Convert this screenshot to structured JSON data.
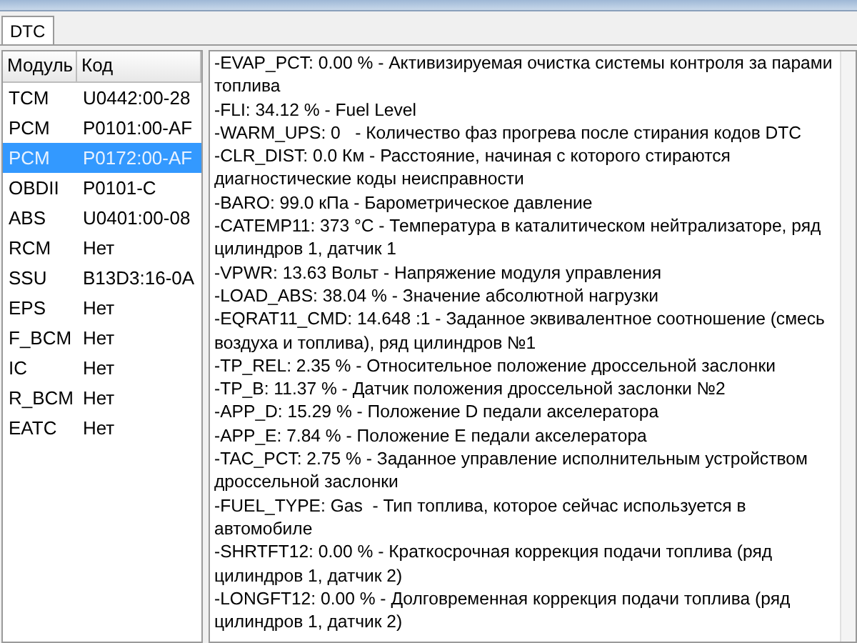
{
  "tabs": [
    {
      "label": "DTC",
      "selected": true
    }
  ],
  "modules": {
    "columns": [
      "Модуль",
      "Код"
    ],
    "rows": [
      {
        "module": "TCM",
        "code": "U0442:00-28",
        "selected": false
      },
      {
        "module": "PCM",
        "code": "P0101:00-AF",
        "selected": false
      },
      {
        "module": "PCM",
        "code": "P0172:00-AF",
        "selected": true
      },
      {
        "module": "OBDII",
        "code": "P0101-C",
        "selected": false
      },
      {
        "module": "ABS",
        "code": "U0401:00-08",
        "selected": false
      },
      {
        "module": "RCM",
        "code": "Нет",
        "selected": false
      },
      {
        "module": "SSU",
        "code": "B13D3:16-0A",
        "selected": false
      },
      {
        "module": "EPS",
        "code": "Нет",
        "selected": false
      },
      {
        "module": "F_BCM",
        "code": "Нет",
        "selected": false
      },
      {
        "module": "IC",
        "code": "Нет",
        "selected": false
      },
      {
        "module": "R_BCM",
        "code": "Нет",
        "selected": false
      },
      {
        "module": "EATC",
        "code": "Нет",
        "selected": false
      }
    ]
  },
  "details": [
    "-EVAP_PCT: 0.00 % - Активизируемая очистка системы контроля за парами топлива",
    "-FLI: 34.12 % - Fuel Level",
    "-WARM_UPS: 0   - Количество фаз прогрева после стирания кодов DTC",
    "-CLR_DIST: 0.0 Км - Расстояние, начиная с которого стираются диагностические коды неисправности",
    "-BARO: 99.0 кПа - Барометрическое давление",
    "-CATEMP11: 373 °C - Температура в каталитическом нейтрализаторе, ряд цилиндров 1, датчик 1",
    "-VPWR: 13.63 Вольт - Напряжение модуля управления",
    "-LOAD_ABS: 38.04 % - Значение абсолютной нагрузки",
    "-EQRAT11_CMD: 14.648 :1 - Заданное эквивалентное соотношение (смесь воздуха и топлива), ряд цилиндров №1",
    "-TP_REL: 2.35 % - Относительное положение дроссельной заслонки",
    "-TP_B: 11.37 % - Датчик положения дроссельной заслонки №2",
    "-APP_D: 15.29 % - Положение D педали акселератора",
    "-APP_E: 7.84 % - Положение E педали акселератора",
    "-TAC_PCT: 2.75 % - Заданное управление исполнительным устройством дроссельной заслонки",
    "-FUEL_TYPE: Gas  - Тип топлива, которое сейчас используется в автомобиле",
    "-SHRTFT12: 0.00 % - Краткосрочная коррекция подачи топлива (ряд цилиндров 1, датчик 2)",
    "-LONGFT12: 0.00 % - Долговременная коррекция подачи топлива (ряд цилиндров 1, датчик 2)"
  ]
}
